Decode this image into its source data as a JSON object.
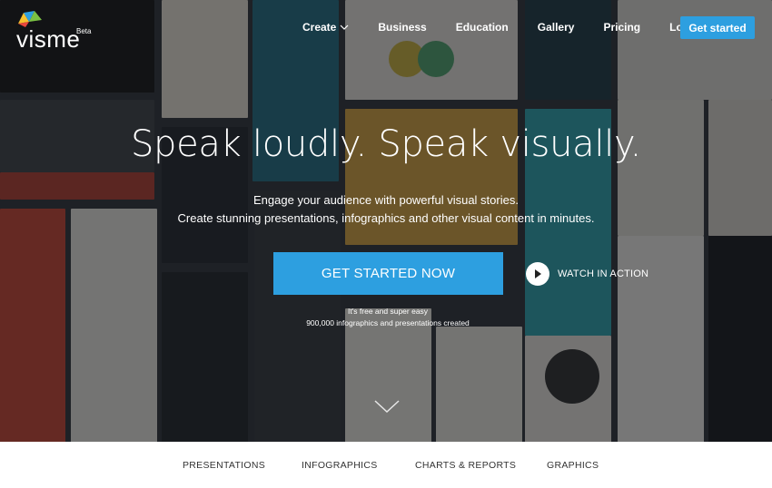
{
  "brand": {
    "name": "visme",
    "badge": "Beta"
  },
  "nav": {
    "items": [
      "Create",
      "Business",
      "Education",
      "Gallery",
      "Pricing",
      "Log in"
    ],
    "cta": "Get started"
  },
  "hero": {
    "headline": "Speak loudly. Speak visually.",
    "subline1": "Engage your audience with powerful visual stories.",
    "subline2": "Create stunning presentations, infographics and other visual content in minutes.",
    "cta": "GET STARTED NOW",
    "watch": "WATCH IN ACTION",
    "note1": "It's free and super easy",
    "note2": "900,000 infographics and presentations created"
  },
  "tabs": [
    "PRESENTATIONS",
    "INFOGRAPHICS",
    "CHARTS & REPORTS",
    "GRAPHICS"
  ],
  "colors": {
    "accent": "#2d9fe0",
    "overlay": "#14161a"
  },
  "icons": [
    "chevron-down-icon",
    "play-icon",
    "scroll-down-icon",
    "visme-logo-icon"
  ]
}
